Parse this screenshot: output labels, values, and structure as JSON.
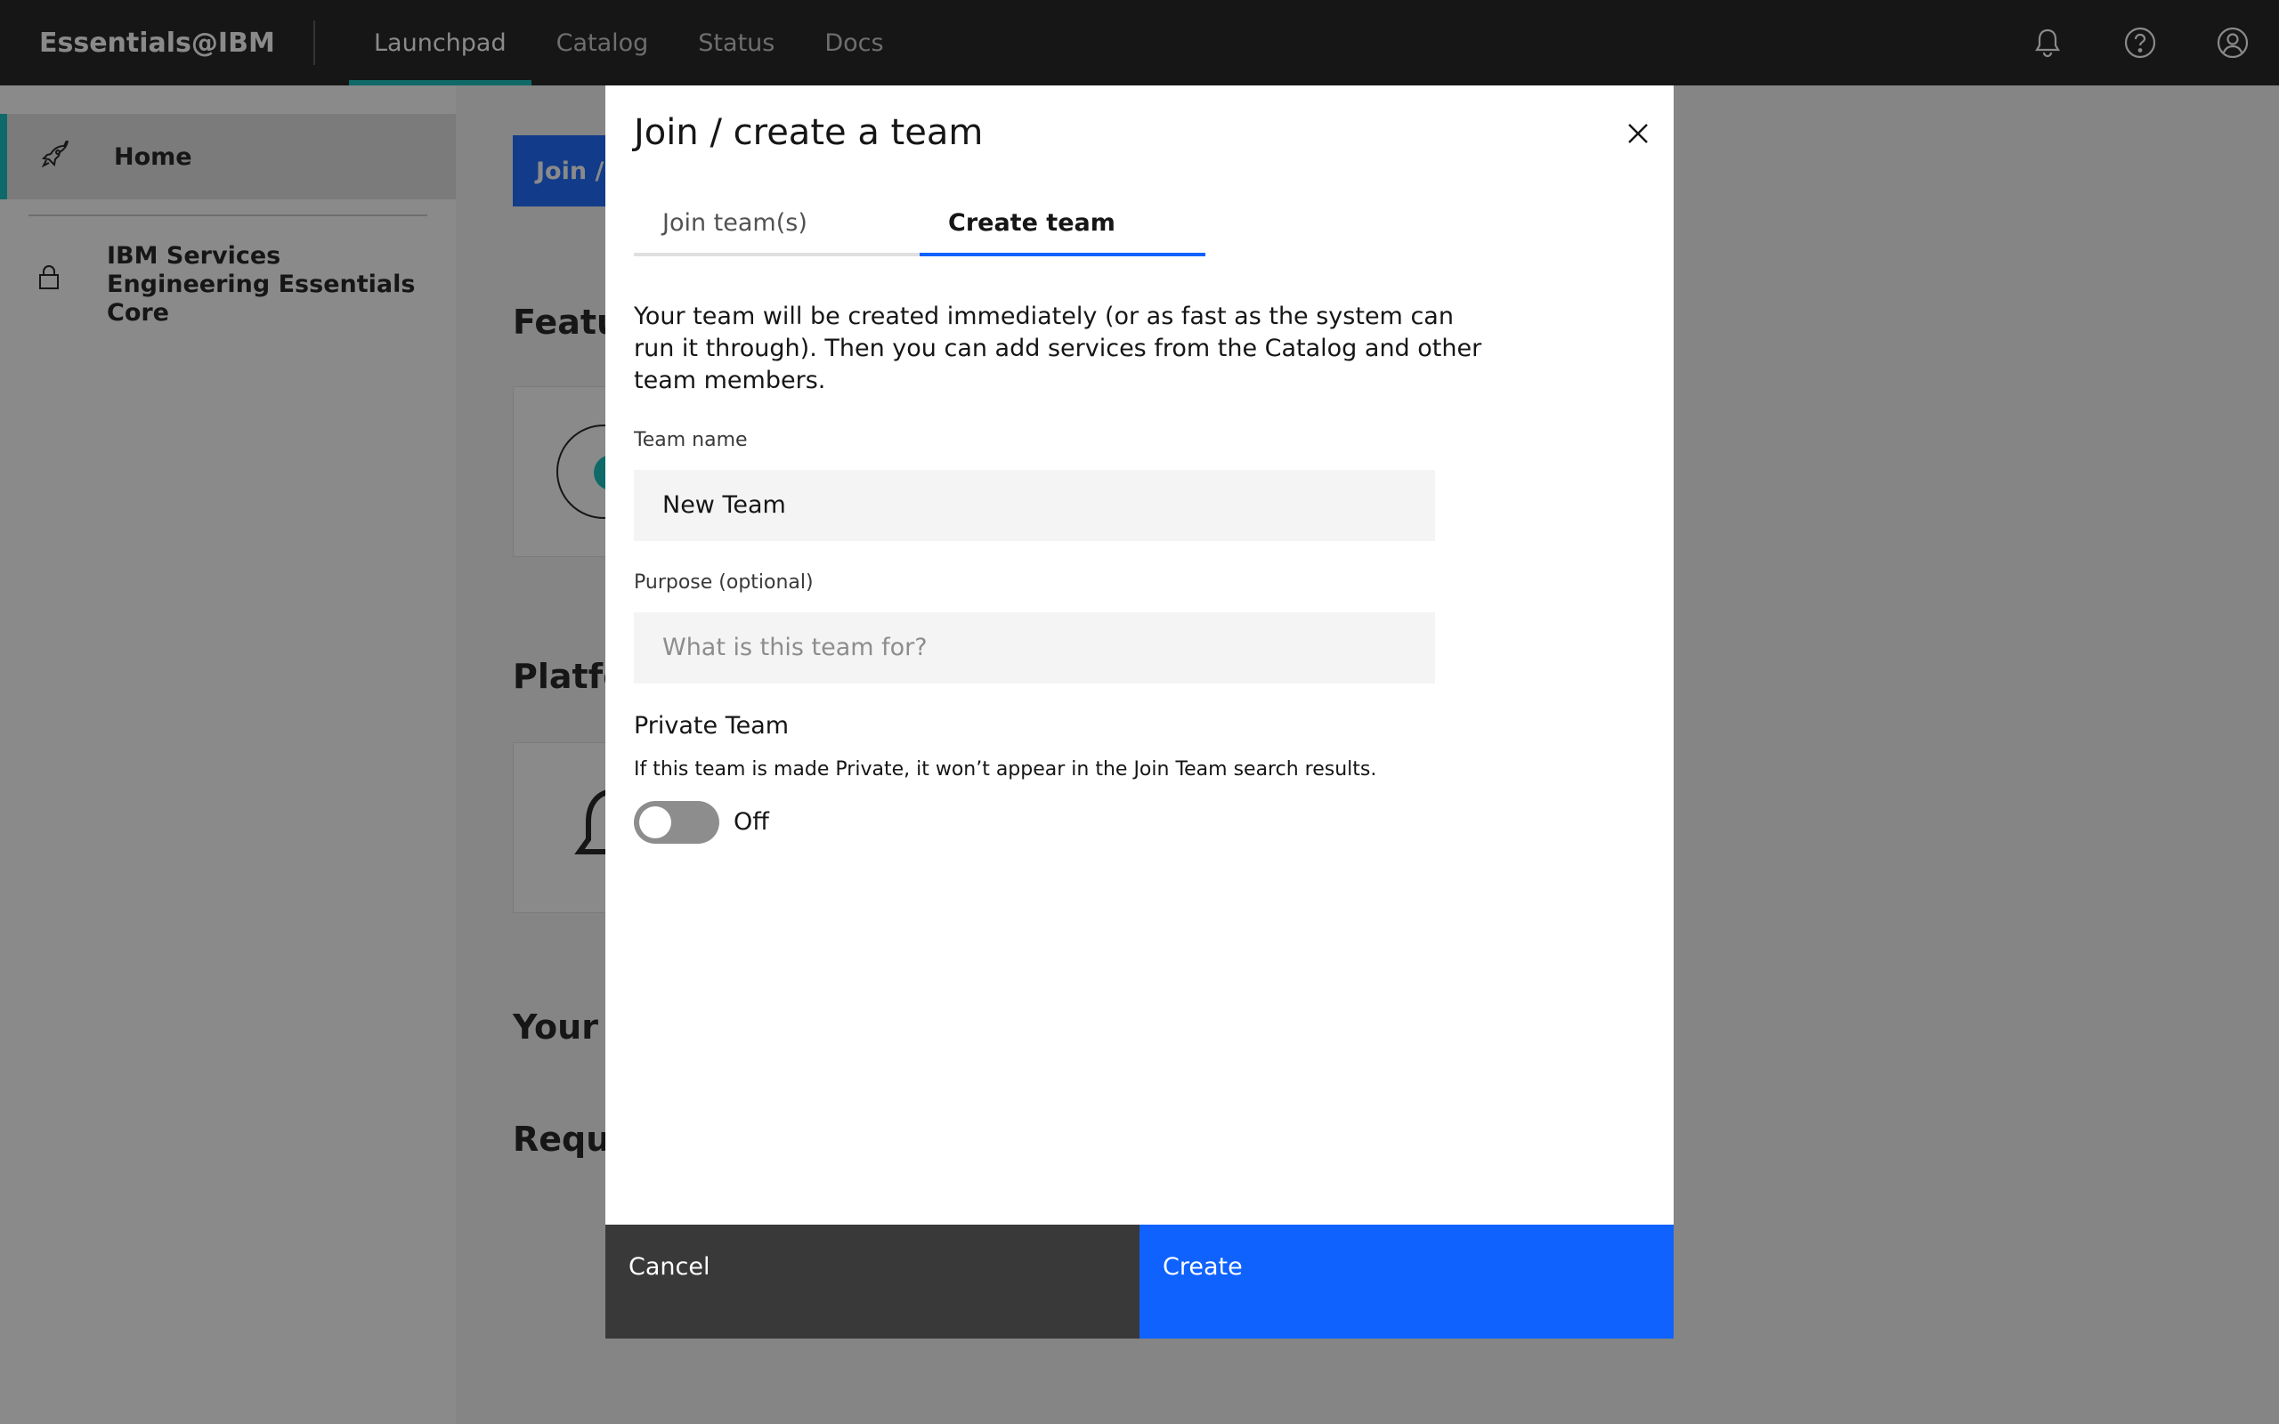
{
  "header": {
    "brand": "Essentials@IBM",
    "nav": [
      "Launchpad",
      "Catalog",
      "Status",
      "Docs"
    ],
    "active_nav": "Launchpad",
    "icons": [
      "notification-icon",
      "help-icon",
      "user-profile-icon"
    ]
  },
  "sidebar": {
    "items": [
      {
        "label": "Home",
        "icon": "rocket-icon",
        "active": true
      },
      {
        "label": "IBM Services Engineering Essentials Core",
        "icon": "lock-icon",
        "active": false
      }
    ]
  },
  "main": {
    "join_button": "Join /",
    "sections": [
      "Featu",
      "Platfo",
      "Your p",
      "Reque"
    ]
  },
  "modal": {
    "title": "Join / create a team",
    "tabs": [
      "Join team(s)",
      "Create team"
    ],
    "active_tab": "Create team",
    "description": "Your team will be created immediately (or as fast as the system can run it through). Then you can add services from the Catalog and other team members.",
    "team_name_label": "Team name",
    "team_name_value": "New Team",
    "purpose_label": "Purpose (optional)",
    "purpose_placeholder": "What is this team for?",
    "private_title": "Private Team",
    "private_help": "If this team is made Private, it won’t appear in the Join Team search results.",
    "toggle_state": "Off",
    "cancel_label": "Cancel",
    "create_label": "Create"
  },
  "colors": {
    "accent_blue": "#0f62fe",
    "teal": "#08bdba",
    "header_bg": "#161616"
  }
}
